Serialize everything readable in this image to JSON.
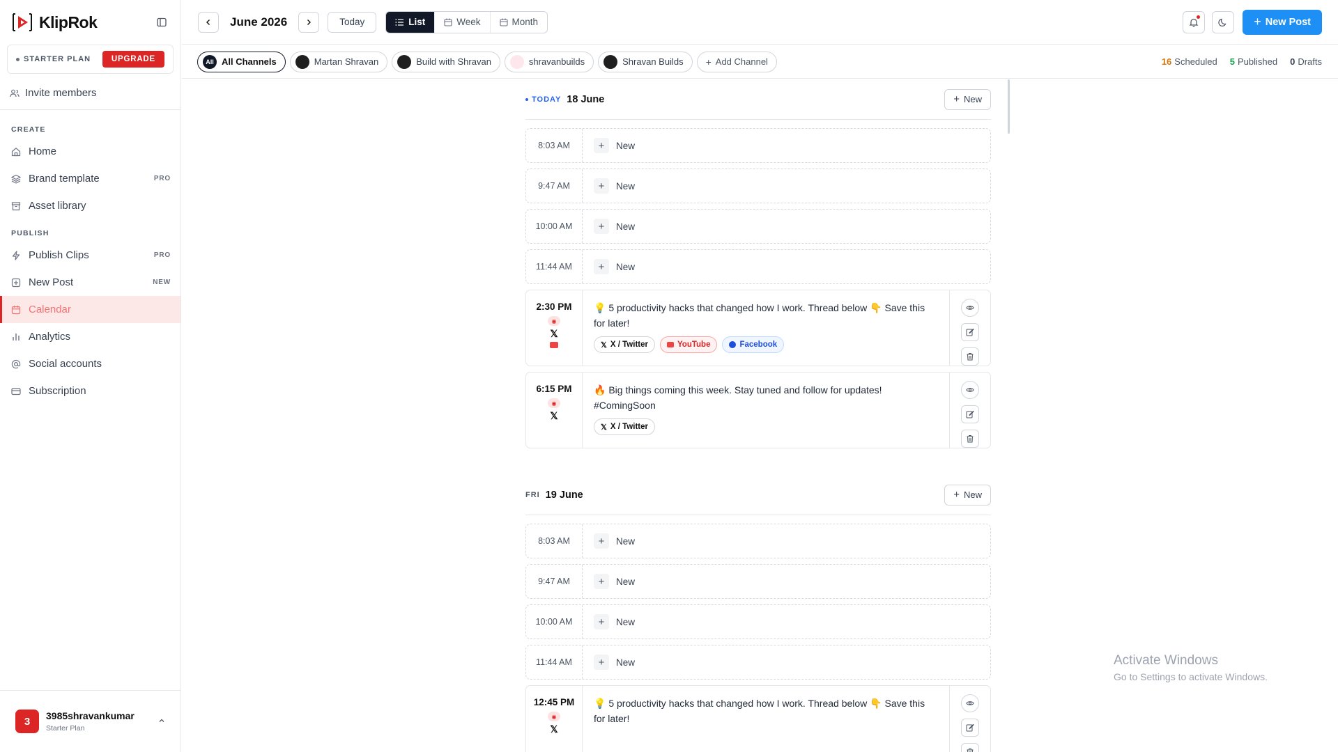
{
  "app": {
    "name": "KlipRok"
  },
  "plan": {
    "label": "STARTER PLAN",
    "upgrade": "UPGRADE"
  },
  "invite": "Invite members",
  "sections": {
    "create": "CREATE",
    "publish": "PUBLISH"
  },
  "nav_create": [
    {
      "label": "Home",
      "badge": "",
      "icon": "home-icon"
    },
    {
      "label": "Brand template",
      "badge": "PRO",
      "icon": "layers-icon"
    },
    {
      "label": "Asset library",
      "badge": "",
      "icon": "archive-icon"
    }
  ],
  "nav_publish": [
    {
      "label": "Publish Clips",
      "badge": "PRO",
      "icon": "bolt-icon"
    },
    {
      "label": "New Post",
      "badge": "NEW",
      "icon": "plus-square-icon"
    },
    {
      "label": "Calendar",
      "badge": "",
      "icon": "calendar-icon",
      "active": true
    },
    {
      "label": "Analytics",
      "badge": "",
      "icon": "bar-chart-icon"
    },
    {
      "label": "Social accounts",
      "badge": "",
      "icon": "at-icon"
    },
    {
      "label": "Subscription",
      "badge": "",
      "icon": "credit-card-icon"
    }
  ],
  "user": {
    "initial": "3",
    "name": "3985shravankumar",
    "plan": "Starter Plan"
  },
  "header": {
    "month": "June 2026",
    "today": "Today",
    "views": [
      "List",
      "Week",
      "Month"
    ],
    "active_view": "List",
    "new_post": "New Post"
  },
  "channels": {
    "all": {
      "badge": "All",
      "label": "All Channels"
    },
    "items": [
      "Martan Shravan",
      "Build with Shravan",
      "shravanbuilds",
      "Shravan Builds"
    ],
    "add": "Add Channel"
  },
  "stats": {
    "scheduled": {
      "count": "16",
      "label": "Scheduled"
    },
    "published": {
      "count": "5",
      "label": "Published"
    },
    "drafts": {
      "count": "0",
      "label": "Drafts"
    }
  },
  "days": [
    {
      "tag": "TODAY",
      "date": "18 June",
      "new": "New",
      "slots": [
        "8:03 AM",
        "9:47 AM",
        "10:00 AM",
        "11:44 AM"
      ],
      "slot_new": "New",
      "posts": [
        {
          "time": "2:30 PM",
          "text": "💡 5 productivity hacks that changed how I work. Thread below 👇 Save this for later!",
          "tags": [
            "X / Twitter",
            "YouTube",
            "Facebook"
          ]
        },
        {
          "time": "6:15 PM",
          "text": "🔥 Big things coming this week. Stay tuned and follow for updates! #ComingSoon",
          "tags": [
            "X / Twitter"
          ]
        }
      ]
    },
    {
      "tag": "FRI",
      "date": "19 June",
      "new": "New",
      "slots": [
        "8:03 AM",
        "9:47 AM",
        "10:00 AM",
        "11:44 AM"
      ],
      "slot_new": "New",
      "posts": [
        {
          "time": "12:45 PM",
          "text": "💡 5 productivity hacks that changed how I work. Thread below 👇 Save this for later!"
        }
      ]
    }
  ],
  "watermark": {
    "line1": "Activate Windows",
    "line2": "Go to Settings to activate Windows."
  }
}
